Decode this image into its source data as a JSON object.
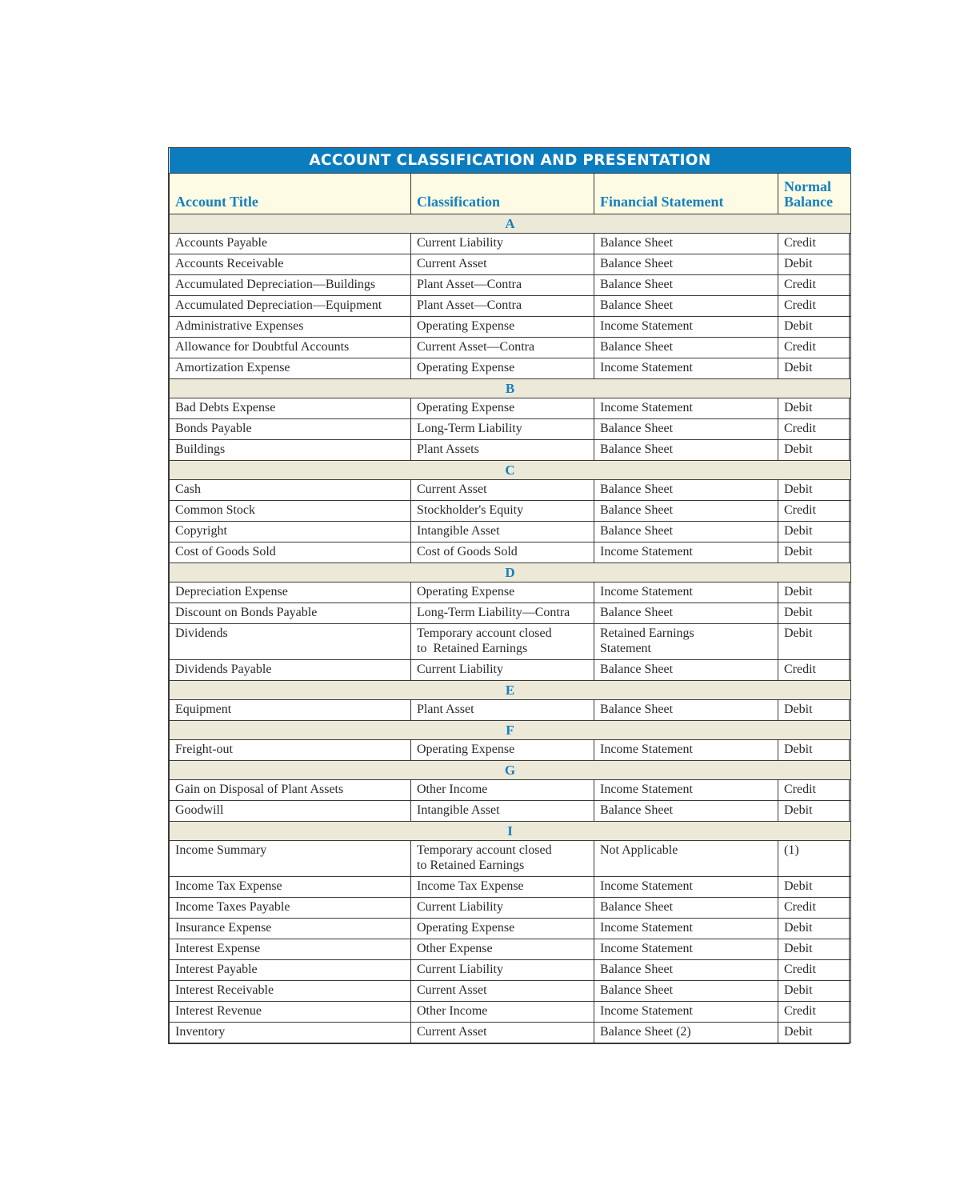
{
  "title": "ACCOUNT CLASSIFICATION AND PRESENTATION",
  "columns": {
    "account_title": "Account Title",
    "classification": "Classification",
    "financial_statement": "Financial Statement",
    "normal_balance_1": "Normal",
    "normal_balance_2": "Balance"
  },
  "sections": [
    {
      "letter": "A",
      "rows": [
        {
          "account": "Accounts Payable",
          "classification": [
            "Current Liability"
          ],
          "statement": [
            "Balance Sheet"
          ],
          "balance": "Credit"
        },
        {
          "account": "Accounts Receivable",
          "classification": [
            "Current Asset"
          ],
          "statement": [
            "Balance Sheet"
          ],
          "balance": "Debit"
        },
        {
          "account": "Accumulated Depreciation—Buildings",
          "classification": [
            "Plant Asset—Contra"
          ],
          "statement": [
            "Balance Sheet"
          ],
          "balance": "Credit"
        },
        {
          "account": "Accumulated Depreciation—Equipment",
          "classification": [
            "Plant Asset—Contra"
          ],
          "statement": [
            "Balance Sheet"
          ],
          "balance": "Credit"
        },
        {
          "account": "Administrative Expenses",
          "classification": [
            "Operating Expense"
          ],
          "statement": [
            "Income Statement"
          ],
          "balance": "Debit"
        },
        {
          "account": "Allowance for Doubtful Accounts",
          "classification": [
            "Current Asset—Contra"
          ],
          "statement": [
            "Balance Sheet"
          ],
          "balance": "Credit"
        },
        {
          "account": "Amortization Expense",
          "classification": [
            "Operating Expense"
          ],
          "statement": [
            "Income Statement"
          ],
          "balance": "Debit"
        }
      ]
    },
    {
      "letter": "B",
      "rows": [
        {
          "account": "Bad Debts Expense",
          "classification": [
            "Operating Expense"
          ],
          "statement": [
            "Income Statement"
          ],
          "balance": "Debit"
        },
        {
          "account": "Bonds Payable",
          "classification": [
            "Long-Term Liability"
          ],
          "statement": [
            "Balance Sheet"
          ],
          "balance": "Credit"
        },
        {
          "account": "Buildings",
          "classification": [
            "Plant Assets"
          ],
          "statement": [
            "Balance Sheet"
          ],
          "balance": "Debit"
        }
      ]
    },
    {
      "letter": "C",
      "rows": [
        {
          "account": "Cash",
          "classification": [
            "Current Asset"
          ],
          "statement": [
            "Balance Sheet"
          ],
          "balance": "Debit"
        },
        {
          "account": "Common Stock",
          "classification": [
            "Stockholder's Equity"
          ],
          "statement": [
            "Balance Sheet"
          ],
          "balance": "Credit"
        },
        {
          "account": "Copyright",
          "classification": [
            "Intangible Asset"
          ],
          "statement": [
            "Balance Sheet"
          ],
          "balance": "Debit"
        },
        {
          "account": "Cost of Goods Sold",
          "classification": [
            "Cost of Goods Sold"
          ],
          "statement": [
            "Income Statement"
          ],
          "balance": "Debit"
        }
      ]
    },
    {
      "letter": "D",
      "rows": [
        {
          "account": "Depreciation Expense",
          "classification": [
            "Operating Expense"
          ],
          "statement": [
            "Income Statement"
          ],
          "balance": "Debit"
        },
        {
          "account": "Discount on Bonds Payable",
          "classification": [
            "Long-Term Liability—Contra"
          ],
          "statement": [
            "Balance Sheet"
          ],
          "balance": "Debit"
        },
        {
          "account": "Dividends",
          "classification": [
            "Temporary account closed",
            "to  Retained Earnings"
          ],
          "statement": [
            "Retained Earnings",
            "Statement"
          ],
          "balance": "Debit"
        },
        {
          "account": "Dividends Payable",
          "classification": [
            "Current Liability"
          ],
          "statement": [
            "Balance Sheet"
          ],
          "balance": "Credit"
        }
      ]
    },
    {
      "letter": "E",
      "rows": [
        {
          "account": "Equipment",
          "classification": [
            "Plant Asset"
          ],
          "statement": [
            "Balance Sheet"
          ],
          "balance": "Debit"
        }
      ]
    },
    {
      "letter": "F",
      "rows": [
        {
          "account": "Freight-out",
          "classification": [
            "Operating Expense"
          ],
          "statement": [
            "Income Statement"
          ],
          "balance": "Debit"
        }
      ]
    },
    {
      "letter": "G",
      "rows": [
        {
          "account": "Gain on Disposal of Plant Assets",
          "classification": [
            "Other Income"
          ],
          "statement": [
            "Income Statement"
          ],
          "balance": "Credit"
        },
        {
          "account": "Goodwill",
          "classification": [
            "Intangible Asset"
          ],
          "statement": [
            "Balance Sheet"
          ],
          "balance": "Debit"
        }
      ]
    },
    {
      "letter": "I",
      "rows": [
        {
          "account": "Income Summary",
          "classification": [
            "Temporary account closed",
            "to Retained Earnings"
          ],
          "statement": [
            "Not Applicable"
          ],
          "balance": "(1)"
        },
        {
          "account": "Income Tax Expense",
          "classification": [
            "Income Tax Expense"
          ],
          "statement": [
            "Income Statement"
          ],
          "balance": "Debit"
        },
        {
          "account": "Income Taxes Payable",
          "classification": [
            "Current Liability"
          ],
          "statement": [
            "Balance Sheet"
          ],
          "balance": "Credit"
        },
        {
          "account": "Insurance Expense",
          "classification": [
            "Operating Expense"
          ],
          "statement": [
            "Income Statement"
          ],
          "balance": "Debit"
        },
        {
          "account": "Interest Expense",
          "classification": [
            "Other Expense"
          ],
          "statement": [
            "Income Statement"
          ],
          "balance": "Debit"
        },
        {
          "account": "Interest Payable",
          "classification": [
            "Current Liability"
          ],
          "statement": [
            "Balance Sheet"
          ],
          "balance": "Credit"
        },
        {
          "account": "Interest Receivable",
          "classification": [
            "Current Asset"
          ],
          "statement": [
            "Balance Sheet"
          ],
          "balance": "Debit"
        },
        {
          "account": "Interest Revenue",
          "classification": [
            "Other Income"
          ],
          "statement": [
            "Income Statement"
          ],
          "balance": "Credit"
        },
        {
          "account": "Inventory",
          "classification": [
            "Current Asset"
          ],
          "statement": [
            "Balance Sheet (2)"
          ],
          "balance": "Debit"
        }
      ]
    }
  ]
}
